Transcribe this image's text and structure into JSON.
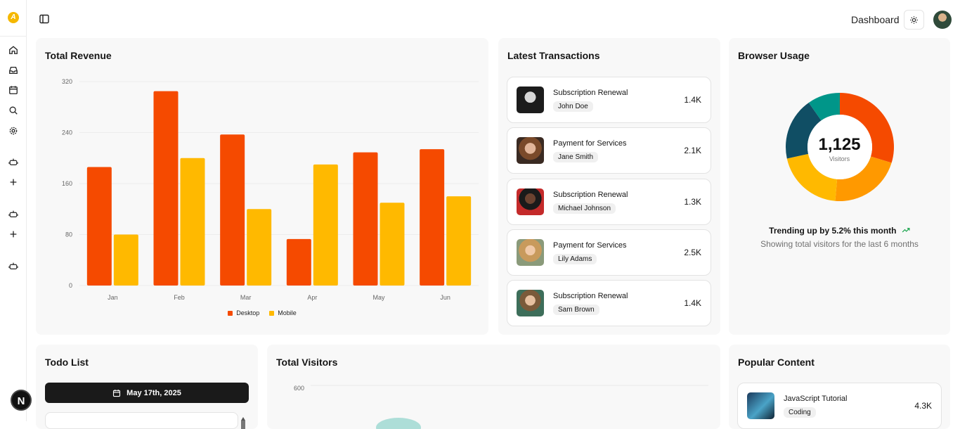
{
  "header": {
    "title": "Dashboard"
  },
  "sidebar": {
    "logo_glyph": "A",
    "items": [
      {
        "icon": "home-icon"
      },
      {
        "icon": "inbox-icon"
      },
      {
        "icon": "calendar-icon"
      },
      {
        "icon": "search-icon"
      },
      {
        "icon": "gear-icon"
      },
      {
        "icon": "bot-icon"
      },
      {
        "icon": "plus-icon"
      },
      {
        "icon": "bot-icon"
      },
      {
        "icon": "plus-icon"
      },
      {
        "icon": "bot-icon"
      }
    ],
    "footer_logo": "N"
  },
  "revenue": {
    "title": "Total Revenue",
    "chart_data": {
      "type": "bar",
      "categories": [
        "Jan",
        "Feb",
        "Mar",
        "Apr",
        "May",
        "Jun"
      ],
      "series": [
        {
          "name": "Desktop",
          "values": [
            186,
            305,
            237,
            73,
            209,
            214
          ],
          "color": "#f54a00"
        },
        {
          "name": "Mobile",
          "values": [
            80,
            200,
            120,
            190,
            130,
            140
          ],
          "color": "#ffb900"
        }
      ],
      "yticks": [
        0,
        80,
        160,
        240,
        320
      ],
      "ylim": [
        0,
        320
      ],
      "grid": true,
      "legend": "bottom"
    }
  },
  "transactions": {
    "title": "Latest Transactions",
    "items": [
      {
        "title": "Subscription Renewal",
        "name": "John Doe",
        "amount": "1.4K"
      },
      {
        "title": "Payment for Services",
        "name": "Jane Smith",
        "amount": "2.1K"
      },
      {
        "title": "Subscription Renewal",
        "name": "Michael Johnson",
        "amount": "1.3K"
      },
      {
        "title": "Payment for Services",
        "name": "Lily Adams",
        "amount": "2.5K"
      },
      {
        "title": "Subscription Renewal",
        "name": "Sam Brown",
        "amount": "1.4K"
      }
    ]
  },
  "browser": {
    "title": "Browser Usage",
    "total": "1,125",
    "total_label": "Visitors",
    "trend_text": "Trending up by 5.2% this month",
    "subtext": "Showing total visitors for the last 6 months",
    "chart_data": {
      "type": "pie",
      "values": [
        275,
        200,
        187,
        173,
        90
      ],
      "colors": [
        "#f54a00",
        "#ff9900",
        "#ffb900",
        "#104e64",
        "#009689"
      ]
    }
  },
  "todo": {
    "title": "Todo List",
    "date_label": "May 17th, 2025"
  },
  "visitors": {
    "title": "Total Visitors",
    "chart_data": {
      "type": "area",
      "yticks": [
        600
      ]
    }
  },
  "popular": {
    "title": "Popular Content",
    "items": [
      {
        "title": "JavaScript Tutorial",
        "tag": "Coding",
        "value": "4.3K"
      }
    ]
  }
}
